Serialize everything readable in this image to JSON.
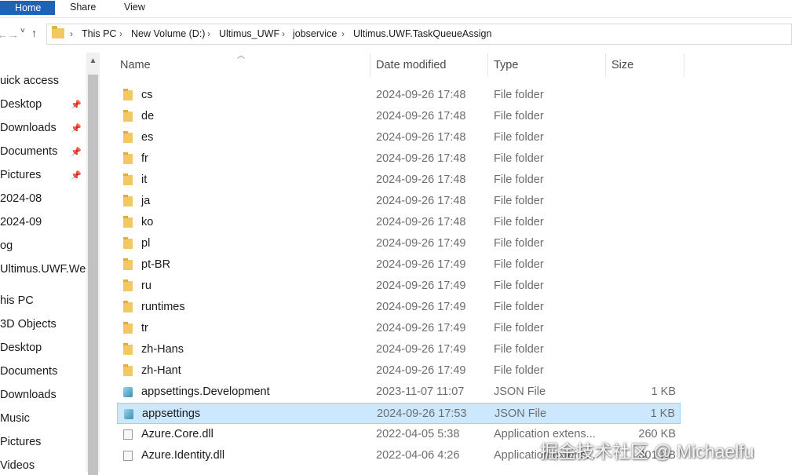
{
  "ribbon": {
    "tabs": [
      "Home",
      "Share",
      "View"
    ]
  },
  "nav": {
    "back": "←",
    "forward": "→",
    "up_dropdown": "˅",
    "up": "↑"
  },
  "address": {
    "crumbs": [
      "This PC",
      "New Volume (D:)",
      "Ultimus_UWF",
      "jobservice",
      "Ultimus.UWF.TaskQueueAssign"
    ],
    "separator": "›"
  },
  "sidebar": {
    "items": [
      {
        "label": "uick access",
        "pinned": false
      },
      {
        "label": "Desktop",
        "pinned": true
      },
      {
        "label": "Downloads",
        "pinned": true
      },
      {
        "label": "Documents",
        "pinned": true
      },
      {
        "label": "Pictures",
        "pinned": true
      },
      {
        "label": "2024-08",
        "pinned": false
      },
      {
        "label": "2024-09",
        "pinned": false
      },
      {
        "label": "og",
        "pinned": false
      },
      {
        "label": "Ultimus.UWF.Wel",
        "pinned": false
      },
      {
        "label": "his PC",
        "pinned": false
      },
      {
        "label": "3D Objects",
        "pinned": false
      },
      {
        "label": "Desktop",
        "pinned": false
      },
      {
        "label": "Documents",
        "pinned": false
      },
      {
        "label": "Downloads",
        "pinned": false
      },
      {
        "label": "Music",
        "pinned": false
      },
      {
        "label": "Pictures",
        "pinned": false
      },
      {
        "label": "Videos",
        "pinned": false
      }
    ],
    "pin_glyph": "📌"
  },
  "columns": {
    "name": "Name",
    "date": "Date modified",
    "type": "Type",
    "size": "Size"
  },
  "files": [
    {
      "name": "cs",
      "date": "2024-09-26 17:48",
      "type": "File folder",
      "size": "",
      "icon": "folder-icon"
    },
    {
      "name": "de",
      "date": "2024-09-26 17:48",
      "type": "File folder",
      "size": "",
      "icon": "folder-icon"
    },
    {
      "name": "es",
      "date": "2024-09-26 17:48",
      "type": "File folder",
      "size": "",
      "icon": "folder-icon"
    },
    {
      "name": "fr",
      "date": "2024-09-26 17:48",
      "type": "File folder",
      "size": "",
      "icon": "folder-icon"
    },
    {
      "name": "it",
      "date": "2024-09-26 17:48",
      "type": "File folder",
      "size": "",
      "icon": "folder-icon"
    },
    {
      "name": "ja",
      "date": "2024-09-26 17:48",
      "type": "File folder",
      "size": "",
      "icon": "folder-icon"
    },
    {
      "name": "ko",
      "date": "2024-09-26 17:48",
      "type": "File folder",
      "size": "",
      "icon": "folder-icon"
    },
    {
      "name": "pl",
      "date": "2024-09-26 17:49",
      "type": "File folder",
      "size": "",
      "icon": "folder-icon"
    },
    {
      "name": "pt-BR",
      "date": "2024-09-26 17:49",
      "type": "File folder",
      "size": "",
      "icon": "folder-icon"
    },
    {
      "name": "ru",
      "date": "2024-09-26 17:49",
      "type": "File folder",
      "size": "",
      "icon": "folder-icon"
    },
    {
      "name": "runtimes",
      "date": "2024-09-26 17:49",
      "type": "File folder",
      "size": "",
      "icon": "folder-icon"
    },
    {
      "name": "tr",
      "date": "2024-09-26 17:49",
      "type": "File folder",
      "size": "",
      "icon": "folder-icon"
    },
    {
      "name": "zh-Hans",
      "date": "2024-09-26 17:49",
      "type": "File folder",
      "size": "",
      "icon": "folder-icon"
    },
    {
      "name": "zh-Hant",
      "date": "2024-09-26 17:49",
      "type": "File folder",
      "size": "",
      "icon": "folder-icon"
    },
    {
      "name": "appsettings.Development",
      "date": "2023-11-07 11:07",
      "type": "JSON File",
      "size": "1 KB",
      "icon": "json-file-icon"
    },
    {
      "name": "appsettings",
      "date": "2024-09-26 17:53",
      "type": "JSON File",
      "size": "1 KB",
      "icon": "json-file-icon",
      "selected": true
    },
    {
      "name": "Azure.Core.dll",
      "date": "2022-04-05 5:38",
      "type": "Application extens...",
      "size": "260 KB",
      "icon": "dll-file-icon"
    },
    {
      "name": "Azure.Identity.dll",
      "date": "2022-04-06 4:26",
      "type": "Application extens...",
      "size": "301 KB",
      "icon": "dll-file-icon"
    }
  ],
  "watermark": "掘金技术社区 @ Michaelfu",
  "colors": {
    "selection_bg": "#cce8ff",
    "selection_border": "#99d1ff",
    "ribbon_accent": "#1f63b8"
  }
}
